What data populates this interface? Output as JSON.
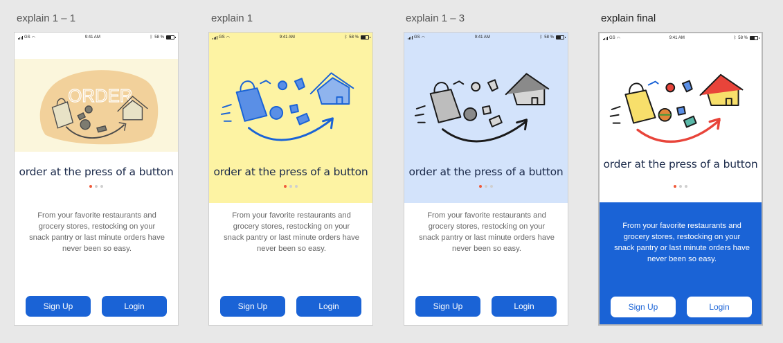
{
  "status_bar": {
    "carrier": "GS",
    "time": "9:41 AM",
    "battery": "58 %"
  },
  "artboards": [
    {
      "label": "explain 1 – 1",
      "hero_bg": "#fbf6dc",
      "headline": "order at the press of a button",
      "body": "From your favorite restaurants and grocery stores, restocking on your snack pantry or last minute orders have never been so easy.",
      "signup": "Sign Up",
      "login": "Login",
      "art_text": "ORDER"
    },
    {
      "label": "explain 1",
      "hero_bg": "#fdf3a3",
      "headline": "order at the press of a button",
      "body": "From your favorite restaurants and grocery stores, restocking on your snack pantry or last minute orders have never been so easy.",
      "signup": "Sign Up",
      "login": "Login"
    },
    {
      "label": "explain 1 – 3",
      "hero_bg": "#d3e3fb",
      "headline": "order at the press of a button",
      "body": "From your favorite restaurants and grocery stores, restocking on your snack pantry or last minute orders have never been so easy.",
      "signup": "Sign Up",
      "login": "Login"
    },
    {
      "label": "explain final",
      "hero_bg": "#ffffff",
      "headline": "order at the press of a button",
      "body": "From your favorite restaurants and grocery stores, restocking on your snack pantry or last minute orders have never been so easy.",
      "signup": "Sign Up",
      "login": "Login"
    }
  ],
  "colors": {
    "primary_blue": "#1a63d6",
    "active_dot": "#f05a3a",
    "inactive_dot": "#cfcfcf",
    "headline": "#1b2a4a"
  },
  "pagination": {
    "pages": 3,
    "active": 1
  }
}
